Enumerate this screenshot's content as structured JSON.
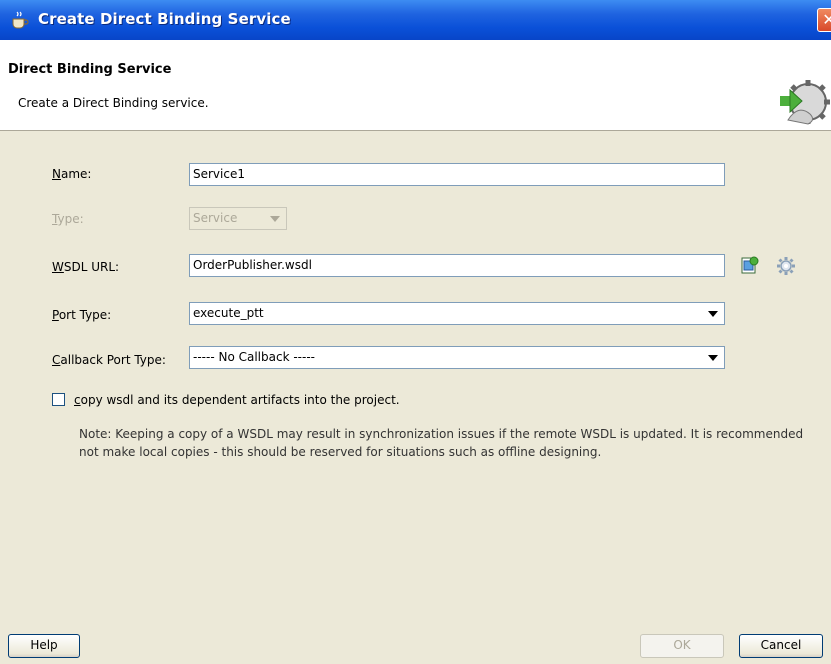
{
  "window": {
    "title": "Create Direct Binding Service",
    "close_label": "✕"
  },
  "header": {
    "title": "Direct Binding Service",
    "subtitle": "Create a Direct Binding service.",
    "icon": "gear-arrow-icon"
  },
  "form": {
    "name": {
      "label": "Name:",
      "value": "Service1"
    },
    "type": {
      "label": "Type:",
      "value": "Service",
      "enabled": false
    },
    "wsdl_url": {
      "label": "WSDL URL:",
      "value": "OrderPublisher.wsdl"
    },
    "port_type": {
      "label": "Port Type:",
      "value": "execute_ptt"
    },
    "callback_port_type": {
      "label": "Callback Port Type:",
      "value": "----- No Callback -----"
    },
    "copy_wsdl": {
      "label": "copy wsdl and its dependent artifacts into the project.",
      "checked": false
    },
    "note": "Note: Keeping a copy of a WSDL may result in synchronization issues if the remote WSDL is updated. It is recommended not make local copies - this should be reserved for situations such as offline designing."
  },
  "buttons": {
    "help": "Help",
    "ok": "OK",
    "cancel": "Cancel"
  },
  "colors": {
    "titlebar": "#0a50d8",
    "dialog_bg": "#ece9d8",
    "field_border": "#7f9db9"
  }
}
